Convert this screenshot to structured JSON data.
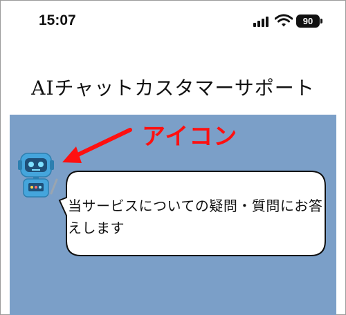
{
  "status_bar": {
    "time": "15:07",
    "battery": "90"
  },
  "header": {
    "title": "AIチャットカスタマーサポート"
  },
  "annotation": {
    "label": "アイコン"
  },
  "chat": {
    "messages": [
      {
        "sender": "bot",
        "text": "当サービスについての疑問・質問にお答えします"
      }
    ]
  },
  "colors": {
    "chat_background": "#7b9fc8",
    "annotation": "#ff1010",
    "bubble_fill": "#ffffff"
  }
}
